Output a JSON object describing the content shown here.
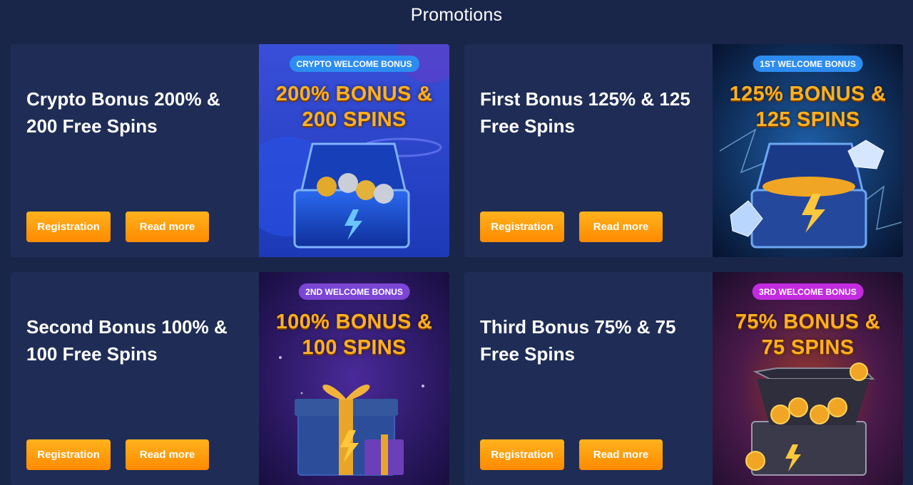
{
  "page": {
    "title": "Promotions"
  },
  "cards": [
    {
      "title": "Crypto Bonus 200% & 200 Free Spins",
      "registration_label": "Registration",
      "read_more_label": "Read more",
      "badge": "CRYPTO WELCOME BONUS",
      "headline_line1": "200% BONUS &",
      "headline_line2": "200 SPINS",
      "badge_color": "#2d8cf0"
    },
    {
      "title": "First Bonus 125% & 125 Free Spins",
      "registration_label": "Registration",
      "read_more_label": "Read more",
      "badge": "1ST WELCOME BONUS",
      "headline_line1": "125% BONUS &",
      "headline_line2": "125 SPINS",
      "badge_color": "#2d8cf0"
    },
    {
      "title": "Second Bonus 100% & 100 Free Spins",
      "registration_label": "Registration",
      "read_more_label": "Read more",
      "badge": "2ND WELCOME BONUS",
      "headline_line1": "100% BONUS &",
      "headline_line2": "100 SPINS",
      "badge_color": "#7b45d6"
    },
    {
      "title": "Third Bonus 75% & 75 Free Spins",
      "registration_label": "Registration",
      "read_more_label": "Read more",
      "badge": "3RD WELCOME BONUS",
      "headline_line1": "75% BONUS &",
      "headline_line2": "75 SPINS",
      "badge_color": "#c22be0"
    }
  ],
  "colors": {
    "background": "#19264a",
    "card": "#1f2d56",
    "button": "#ff9a0a",
    "headline": "#ffb020"
  }
}
